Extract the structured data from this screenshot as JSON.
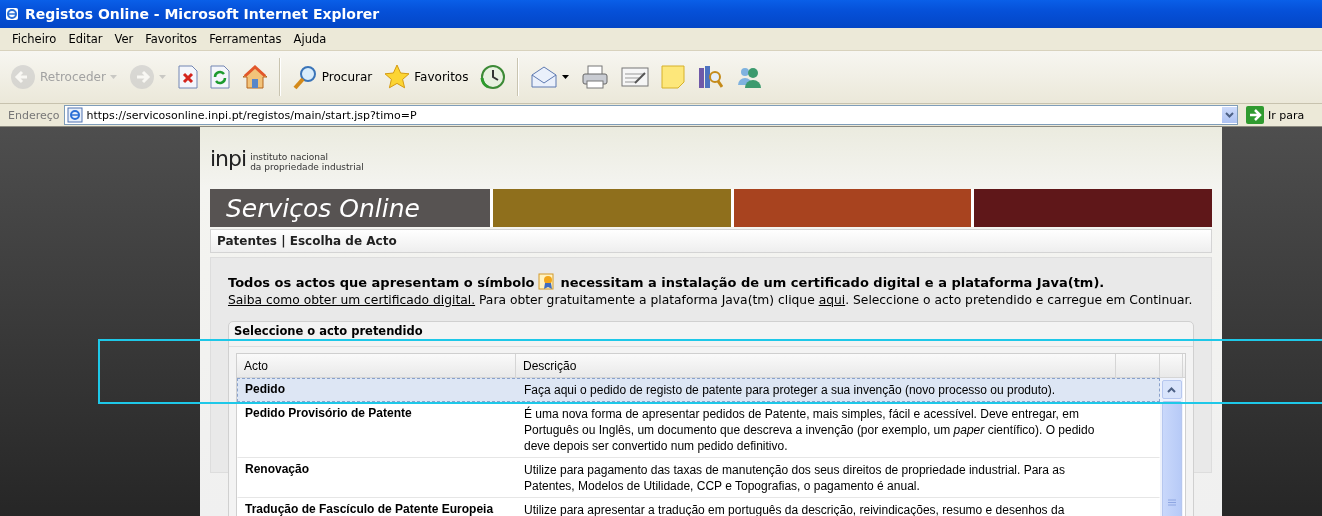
{
  "window": {
    "title": "Registos Online - Microsoft Internet Explorer"
  },
  "menu": [
    "Ficheiro",
    "Editar",
    "Ver",
    "Favoritos",
    "Ferramentas",
    "Ajuda"
  ],
  "toolbar": [
    {
      "kind": "labeled",
      "label": "Retroceder",
      "disabled": true,
      "dropdown": true
    },
    {
      "kind": "icon",
      "disabled": true,
      "dropdown": true
    },
    {
      "kind": "icon",
      "disabled": false,
      "dropdown": false
    },
    {
      "kind": "icon",
      "disabled": false,
      "dropdown": false
    },
    {
      "kind": "icon",
      "disabled": false,
      "dropdown": false
    },
    {
      "kind": "separator"
    },
    {
      "kind": "labeled",
      "label": "Procurar",
      "disabled": false,
      "dropdown": false
    },
    {
      "kind": "labeled",
      "label": "Favoritos",
      "disabled": false,
      "dropdown": false
    },
    {
      "kind": "icon",
      "disabled": false,
      "dropdown": false
    },
    {
      "kind": "separator"
    },
    {
      "kind": "icon",
      "disabled": false,
      "dropdown": true
    },
    {
      "kind": "icon",
      "disabled": false,
      "dropdown": false
    },
    {
      "kind": "icon",
      "disabled": false,
      "dropdown": false
    },
    {
      "kind": "icon",
      "disabled": false,
      "dropdown": false
    },
    {
      "kind": "icon",
      "disabled": false,
      "dropdown": false
    },
    {
      "kind": "icon",
      "disabled": false,
      "dropdown": false
    }
  ],
  "address_bar": {
    "label": "Endereço",
    "value": "https://servicosonline.inpi.pt/registos/main/start.jsp?timo=P",
    "go_label": "Ir para"
  },
  "site": {
    "logo": "inpi",
    "logo_line1": "instituto nacional",
    "logo_line2": "da propriedade industrial",
    "banner_title": "Serviços Online"
  },
  "breadcrumb": "Patentes | Escolha de Acto",
  "intro": {
    "lead": "Todos os actos que apresentam o símbolo",
    "lead_after": "necessitam a instalação de um certificado digital e a plataforma Java(tm).",
    "link_certificate": "Saiba como obter um certificado digital.",
    "text_java": "Para obter gratuitamente a plataforma Java(tm) clique",
    "link_java": "aqui",
    "text_end": ". Seleccione o acto pretendido e carregue em Continuar."
  },
  "panel": {
    "title": "Seleccione o acto pretendido"
  },
  "table": {
    "columns": [
      "Acto",
      "Descrição"
    ],
    "rows": [
      {
        "acto": "Pedido",
        "descricao": "Faça aqui o pedido de registo de patente para proteger a sua invenção (novo processo ou produto).",
        "selected": true
      },
      {
        "acto": "Pedido Provisório de Patente",
        "descricao": "É uma nova forma de apresentar pedidos de Patente, mais simples, fácil e acessível. Deve entregar, em Português ou Inglês, um documento que descreva a invenção (por exemplo, um *paper* científico). O pedido deve depois ser convertido num pedido definitivo.",
        "selected": false
      },
      {
        "acto": "Renovação",
        "descricao": "Utilize para pagamento das taxas de manutenção dos seus direitos de propriedade industrial. Para as Patentes, Modelos de Utilidade, CCP e Topografias, o pagamento é anual.",
        "selected": false
      },
      {
        "acto": "Tradução de Fascículo de Patente Europeia",
        "descricao": "Utilize para apresentar a tradução em português da descrição, reivindicações, resumo e desenhos da",
        "selected": false
      }
    ]
  }
}
